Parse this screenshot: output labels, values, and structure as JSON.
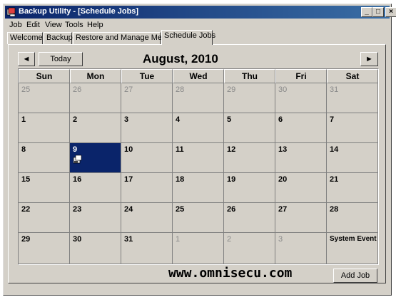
{
  "window": {
    "title": "Backup Utility - [Schedule Jobs]",
    "controls": {
      "minimize": "_",
      "maximize": "□",
      "close": "×"
    }
  },
  "menu": [
    {
      "label": "Job"
    },
    {
      "label": "Edit"
    },
    {
      "label": "View"
    },
    {
      "label": "Tools"
    },
    {
      "label": "Help"
    }
  ],
  "tabs": [
    {
      "label": "Welcome"
    },
    {
      "label": "Backup"
    },
    {
      "label": "Restore and Manage Media"
    },
    {
      "label": "Schedule Jobs",
      "active": true
    }
  ],
  "calendar": {
    "prev_glyph": "◄",
    "next_glyph": "►",
    "today_label": "Today",
    "month_label": "August, 2010",
    "weekdays": [
      "Sun",
      "Mon",
      "Tue",
      "Wed",
      "Thu",
      "Fri",
      "Sat"
    ],
    "weeks": [
      [
        {
          "day": "25",
          "dim": true
        },
        {
          "day": "26",
          "dim": true
        },
        {
          "day": "27",
          "dim": true
        },
        {
          "day": "28",
          "dim": true
        },
        {
          "day": "29",
          "dim": true
        },
        {
          "day": "30",
          "dim": true
        },
        {
          "day": "31",
          "dim": true
        }
      ],
      [
        {
          "day": "1"
        },
        {
          "day": "2"
        },
        {
          "day": "3"
        },
        {
          "day": "4"
        },
        {
          "day": "5"
        },
        {
          "day": "6"
        },
        {
          "day": "7"
        }
      ],
      [
        {
          "day": "8"
        },
        {
          "day": "9",
          "selected": true,
          "job_icon": true
        },
        {
          "day": "10"
        },
        {
          "day": "11"
        },
        {
          "day": "12"
        },
        {
          "day": "13"
        },
        {
          "day": "14"
        }
      ],
      [
        {
          "day": "15"
        },
        {
          "day": "16"
        },
        {
          "day": "17"
        },
        {
          "day": "18"
        },
        {
          "day": "19"
        },
        {
          "day": "20"
        },
        {
          "day": "21"
        }
      ],
      [
        {
          "day": "22"
        },
        {
          "day": "23"
        },
        {
          "day": "24"
        },
        {
          "day": "25"
        },
        {
          "day": "26"
        },
        {
          "day": "27"
        },
        {
          "day": "28"
        }
      ],
      [
        {
          "day": "29"
        },
        {
          "day": "30"
        },
        {
          "day": "31"
        },
        {
          "day": "1",
          "dim": true
        },
        {
          "day": "2",
          "dim": true
        },
        {
          "day": "3",
          "dim": true
        },
        {
          "label": "System Event"
        }
      ]
    ]
  },
  "footer": {
    "watermark": "www.omnisecu.com",
    "add_job_label": "Add Job"
  },
  "colors": {
    "face": "#d4d0c8",
    "title_gradient_start": "#0a246a",
    "title_gradient_end": "#3a6ea5",
    "selected_day": "#0a246a",
    "dim_text": "#8a8a8a"
  }
}
